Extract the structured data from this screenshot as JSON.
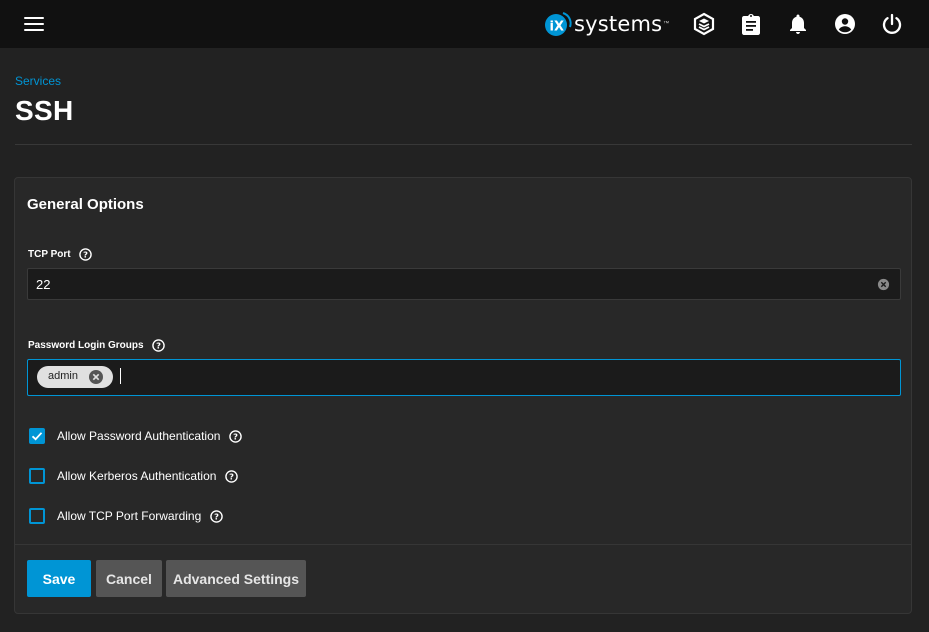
{
  "topbar": {
    "logo_text": "systems",
    "logo_mark": "iX",
    "logo_tm": "™",
    "icons": [
      "menu-icon",
      "truecommand-icon",
      "clipboard-icon",
      "bell-icon",
      "account-icon",
      "power-icon"
    ]
  },
  "breadcrumb": "Services",
  "page_title": "SSH",
  "card": {
    "title": "General Options",
    "tcp_port": {
      "label": "TCP Port",
      "value": "22"
    },
    "password_login_groups": {
      "label": "Password Login Groups",
      "chips": [
        "admin"
      ]
    },
    "checkboxes": [
      {
        "label": "Allow Password Authentication",
        "checked": true
      },
      {
        "label": "Allow Kerberos Authentication",
        "checked": false
      },
      {
        "label": "Allow TCP Port Forwarding",
        "checked": false
      }
    ]
  },
  "buttons": {
    "save": "Save",
    "cancel": "Cancel",
    "advanced": "Advanced Settings"
  },
  "colors": {
    "accent": "#0095d5",
    "background": "#222222",
    "topbar": "#111111",
    "card": "#282828"
  }
}
